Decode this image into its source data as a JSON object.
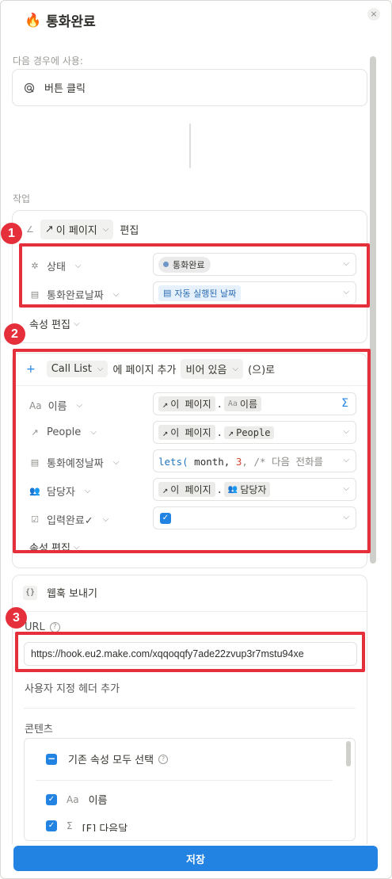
{
  "header": {
    "icon": "flame-icon",
    "title": "통화완료",
    "close": "×"
  },
  "trigger": {
    "section_label": "다음 경우에 사용:",
    "button_label": "버튼 클릭"
  },
  "actions": {
    "section_label": "작업"
  },
  "edit_action": {
    "target": "이 페이지",
    "verb": "편집",
    "props": [
      {
        "name": "상태",
        "value": "통화완료"
      },
      {
        "name": "통화완료날짜",
        "value": "자동 실행된 날짜"
      }
    ],
    "edit_props": "속성 편집"
  },
  "add_action": {
    "database": "Call List",
    "mid_text": "에 페이지 추가",
    "mode": "비어 있음",
    "suffix": "(으)로",
    "props": [
      {
        "name": "이름",
        "ref_page": "이 페이지",
        "ref_prop": "이름",
        "extra": "Σ"
      },
      {
        "name": "People",
        "ref_page": "이 페이지",
        "ref_prop": "People"
      },
      {
        "name": "통화예정날짜",
        "code_fn": "lets(",
        "code_arg": " month, ",
        "code_num": "3",
        "code_rest": ", /* 다음 전화를"
      },
      {
        "name": "담당자",
        "ref_page": "이 페이지",
        "ref_prop": "담당자"
      },
      {
        "name": "입력완료✓",
        "checked": true
      }
    ],
    "edit_props": "속성 편집"
  },
  "webhook": {
    "title": "웹훅 보내기",
    "url_label": "URL",
    "url_value": "https://hook.eu2.make.com/xqqoqqfy7ade22zvup3r7mstu94xe",
    "custom_header": "사용자 지정 헤더 추가",
    "content_label": "콘텐츠",
    "select_all": "기존 속성 모두 선택",
    "items": [
      "이름",
      "[F] 다음달"
    ]
  },
  "badges": [
    "1",
    "2",
    "3"
  ],
  "footer": {
    "save": "저장"
  },
  "colors": {
    "accent": "#2383e2",
    "highlight": "#e5303c"
  }
}
